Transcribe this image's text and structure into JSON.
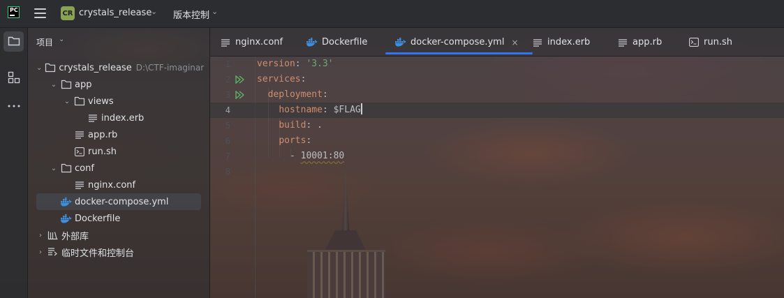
{
  "titlebar": {
    "logo": "PC",
    "project_badge": "CR",
    "project_name": "crystals_release",
    "vcs_label": "版本控制"
  },
  "toolstrip": {
    "icons": [
      "folder-icon",
      "structure-icon",
      "more-icon"
    ]
  },
  "project_panel": {
    "title": "项目",
    "tree": [
      {
        "label": "crystals_release",
        "path": "D:\\CTF-imaginar",
        "icon": "folder",
        "expanded": true,
        "depth": 0
      },
      {
        "label": "app",
        "icon": "folder",
        "expanded": true,
        "depth": 1
      },
      {
        "label": "views",
        "icon": "folder",
        "expanded": true,
        "depth": 2
      },
      {
        "label": "index.erb",
        "icon": "text-file",
        "depth": 3
      },
      {
        "label": "app.rb",
        "icon": "text-file",
        "depth": 2
      },
      {
        "label": "run.sh",
        "icon": "shell-file",
        "depth": 2
      },
      {
        "label": "conf",
        "icon": "folder",
        "expanded": true,
        "depth": 1
      },
      {
        "label": "nginx.conf",
        "icon": "text-file",
        "depth": 2
      },
      {
        "label": "docker-compose.yml",
        "icon": "docker-file",
        "depth": 1,
        "selected": true
      },
      {
        "label": "Dockerfile",
        "icon": "docker-file",
        "depth": 1
      },
      {
        "label": "外部库",
        "icon": "library",
        "expanded": false,
        "depth": 0
      },
      {
        "label": "临时文件和控制台",
        "icon": "scratch",
        "expanded": false,
        "depth": 0
      }
    ]
  },
  "tabs": [
    {
      "label": "nginx.conf",
      "icon": "text-file"
    },
    {
      "label": "Dockerfile",
      "icon": "docker-file"
    },
    {
      "label": "docker-compose.yml",
      "icon": "docker-file",
      "active": true,
      "close": "×"
    },
    {
      "label": "index.erb",
      "icon": "text-file"
    },
    {
      "label": "app.rb",
      "icon": "text-file"
    },
    {
      "label": "run.sh",
      "icon": "shell-file"
    }
  ],
  "editor": {
    "current_line": 4,
    "lines": [
      {
        "n": "1",
        "key": "version",
        "sep": ": ",
        "str": "'3.3'"
      },
      {
        "n": "2",
        "key": "services",
        "sep": ":",
        "run": true
      },
      {
        "n": "3",
        "indent": "  ",
        "key": "deployment",
        "sep": ":",
        "run": true
      },
      {
        "n": "4",
        "indent": "    ",
        "key": "hostname",
        "sep": ": ",
        "val": "$FLAG",
        "caret": true
      },
      {
        "n": "5",
        "indent": "    ",
        "key": "build",
        "sep": ": ",
        "val": "."
      },
      {
        "n": "6",
        "indent": "    ",
        "key": "ports",
        "sep": ":"
      },
      {
        "n": "7",
        "indent": "      ",
        "dash": "- ",
        "val": "10001:80",
        "squiggle": true
      },
      {
        "n": "8"
      }
    ]
  },
  "colors": {
    "accent": "#3574f0",
    "yaml_key": "#cf8e6d",
    "yaml_string": "#6aab73",
    "docker_blue": "#3d8fe0",
    "run_green": "#5fb865"
  }
}
